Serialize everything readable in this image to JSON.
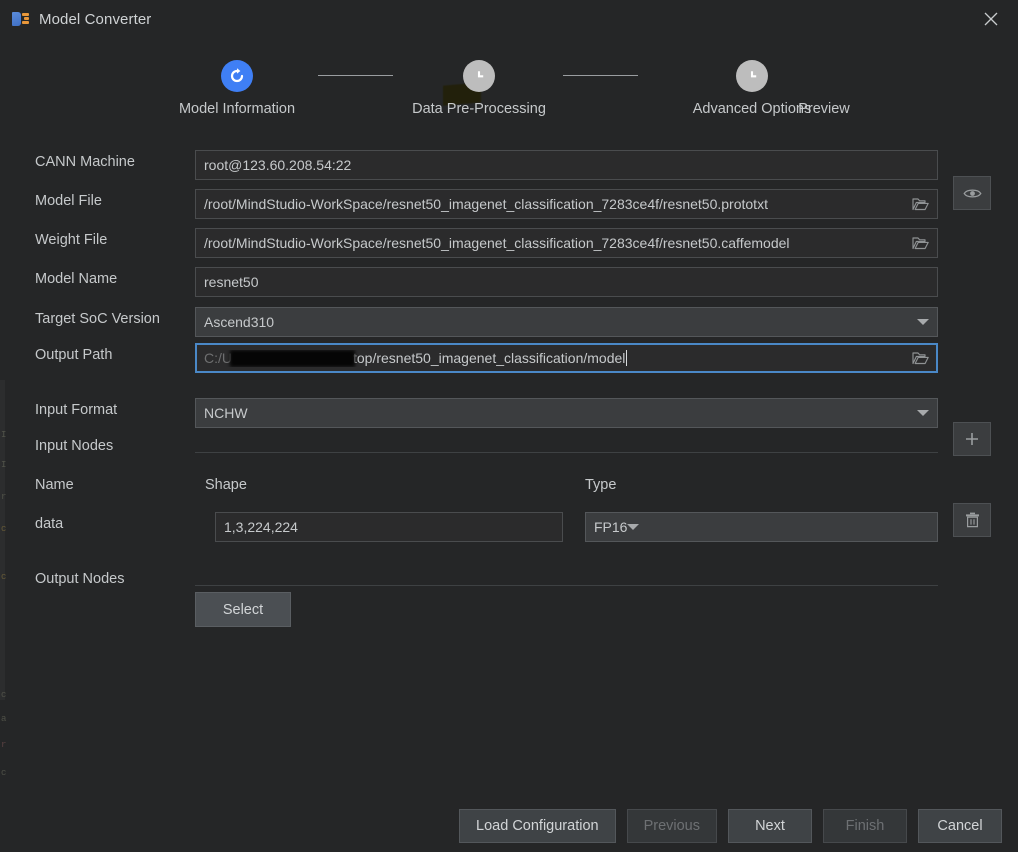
{
  "window": {
    "title": "Model Converter",
    "app_icon": "model-converter-icon",
    "close_icon": "close-icon"
  },
  "stepper": {
    "steps": [
      {
        "label": "Model Information",
        "state": "active",
        "icon": "refresh-circle-icon"
      },
      {
        "label": "Data Pre-Processing",
        "state": "idle",
        "icon": "clock-icon"
      },
      {
        "label": "Advanced Options",
        "state": "idle",
        "icon": "clock-icon"
      }
    ],
    "trailing_label": "Preview"
  },
  "form": {
    "cann_machine": {
      "label": "CANN Machine",
      "value": "root@123.60.208.54:22"
    },
    "model_file": {
      "label": "Model File",
      "value": "/root/MindStudio-WorkSpace/resnet50_imagenet_classification_7283ce4f/resnet50.prototxt",
      "browse_icon": "folder-open-icon"
    },
    "weight_file": {
      "label": "Weight File",
      "value": "/root/MindStudio-WorkSpace/resnet50_imagenet_classification_7283ce4f/resnet50.caffemodel",
      "browse_icon": "folder-open-icon"
    },
    "model_name": {
      "label": "Model Name",
      "value": "resnet50"
    },
    "target_soc_version": {
      "label": "Target SoC Version",
      "value": "Ascend310",
      "dropdown_icon": "chevron-down-icon"
    },
    "output_path": {
      "label": "Output Path",
      "value_prefix": "C:/U",
      "value_redacted": true,
      "value_suffix": "top/resnet50_imagenet_classification/model",
      "focused": true,
      "browse_icon": "folder-open-icon"
    },
    "input_format": {
      "label": "Input Format",
      "value": "NCHW",
      "dropdown_icon": "chevron-down-icon"
    },
    "input_nodes": {
      "label": "Input Nodes",
      "add_icon": "plus-icon",
      "delete_icon": "trash-icon",
      "columns": {
        "name": "Name",
        "shape": "Shape",
        "type": "Type"
      },
      "rows": [
        {
          "name": "data",
          "shape": "1,3,224,224",
          "type": "FP16"
        }
      ]
    },
    "output_nodes": {
      "label": "Output Nodes",
      "select_label": "Select"
    },
    "preview_icon": "eye-icon"
  },
  "footer": {
    "buttons": [
      {
        "label": "Load Configuration",
        "name": "load-configuration-button",
        "disabled": false
      },
      {
        "label": "Previous",
        "name": "previous-button",
        "disabled": true
      },
      {
        "label": "Next",
        "name": "next-button",
        "disabled": false
      },
      {
        "label": "Finish",
        "name": "finish-button",
        "disabled": true
      },
      {
        "label": "Cancel",
        "name": "cancel-button",
        "disabled": false
      }
    ]
  },
  "colors": {
    "dialog_bg": "#252627",
    "accent_blue": "#3f7ff5",
    "focus_border": "#4a88c7",
    "text": "#c6c9cb",
    "input_bg": "#2b2b2c",
    "combo_bg": "#3b3d3f"
  }
}
